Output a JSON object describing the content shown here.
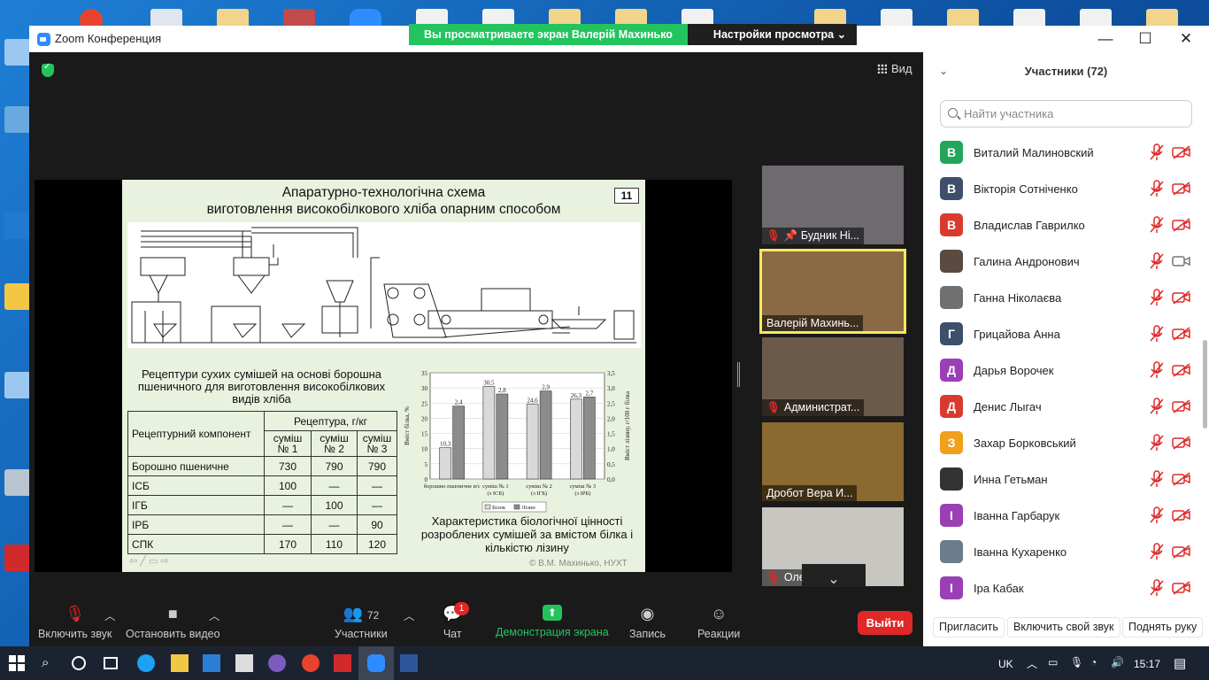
{
  "window": {
    "title": "Zoom Конференция"
  },
  "share_bar": {
    "viewing": "Вы просматриваете экран Валерій Махинько",
    "settings": "Настройки просмотра"
  },
  "view_button": "Вид",
  "slide": {
    "number": "11",
    "title_line1": "Апаратурно-технологічна схема",
    "title_line2": "виготовлення високобілкового хліба опарним способом",
    "table_caption": "Рецептури сухих сумішей на основі борошна пшеничного для виготовлення високобілкових видів хліба",
    "table": {
      "header_component": "Рецептурний компонент",
      "header_recipe": "Рецептура, г/кг",
      "cols": [
        "суміш № 1",
        "суміш № 2",
        "суміш № 3"
      ],
      "rows": [
        {
          "name": "Борошно пшеничне",
          "values": [
            "730",
            "790",
            "790"
          ]
        },
        {
          "name": "ІСБ",
          "values": [
            "100",
            "—",
            "—"
          ]
        },
        {
          "name": "ІГБ",
          "values": [
            "—",
            "100",
            "—"
          ]
        },
        {
          "name": "ІРБ",
          "values": [
            "—",
            "—",
            "90"
          ]
        },
        {
          "name": "СПК",
          "values": [
            "170",
            "110",
            "120"
          ]
        }
      ]
    },
    "chart_caption": "Характеристика біологічної цінності розроблених сумішей за вмістом білка і кількістю лізину",
    "copyright": "© В.М. Махинько, НУХТ"
  },
  "chart_data": {
    "type": "bar",
    "categories": [
      "борошно пшеничне в/с",
      "суміш № 1 (з ІСБ)",
      "суміш № 2 (з ІГБ)",
      "суміш № 3 (з ІРБ)"
    ],
    "series": [
      {
        "name": "Білок",
        "values": [
          10.3,
          30.5,
          24.6,
          26.3
        ],
        "color": "#d9d9d9"
      },
      {
        "name": "Лізин",
        "values": [
          2.4,
          2.8,
          2.9,
          2.7
        ],
        "color": "#8c8c8c"
      }
    ],
    "ylabel": "Вміст білка, %",
    "y2label": "Вміст лізину, г/100 г білка",
    "ylim": [
      0,
      35
    ],
    "y2lim": [
      0,
      3.5
    ],
    "yticks": [
      "0",
      "5",
      "10",
      "15",
      "20",
      "25",
      "30",
      "35"
    ],
    "y2ticks": [
      "0,0",
      "0,5",
      "1,0",
      "1,5",
      "2,0",
      "2,5",
      "3,0",
      "3,5"
    ],
    "data_labels": [
      [
        "10,3",
        "2,4"
      ],
      [
        "30,5",
        "2,8"
      ],
      [
        "24,6",
        "2,9"
      ],
      [
        "26,3",
        "2,7"
      ]
    ],
    "legend": "bottom"
  },
  "thumbnails": [
    {
      "name": "Будник Ні...",
      "muted": true,
      "bg": "#6e6a70"
    },
    {
      "name": "Валерій Махинь...",
      "muted": false,
      "bg": "#8a6a44"
    },
    {
      "name": "Администрат...",
      "muted": true,
      "bg": "#6b5a4a"
    },
    {
      "name": "Дробот Вера И...",
      "muted": false,
      "bg": "#8a6a30"
    },
    {
      "name": "Олена Кохан",
      "muted": true,
      "bg": "#c8c6c0"
    }
  ],
  "toolbar": {
    "audio": "Включить звук",
    "video": "Остановить видео",
    "participants": "Участники",
    "participants_count": "72",
    "chat": "Чат",
    "chat_badge": "1",
    "share": "Демонстрация экрана",
    "record": "Запись",
    "reactions": "Реакции",
    "leave": "Выйти"
  },
  "panel": {
    "title": "Участники (72)",
    "search_placeholder": "Найти участника",
    "participants": [
      {
        "initial": "В",
        "name": "Виталий Малиновский",
        "color": "#23a55a",
        "cam": "off"
      },
      {
        "initial": "В",
        "name": "Вікторія Сотніченко",
        "color": "#3d4f6b",
        "cam": "off"
      },
      {
        "initial": "В",
        "name": "Владислав Гаврилко",
        "color": "#d83b2d",
        "cam": "off"
      },
      {
        "initial": "",
        "name": "Галина Андронович",
        "color": "#5a4a40",
        "cam": "on"
      },
      {
        "initial": "",
        "name": "Ганна Ніколаєва",
        "color": "#707070",
        "cam": "off"
      },
      {
        "initial": "Г",
        "name": "Грицайова Анна",
        "color": "#3d4f6b",
        "cam": "off"
      },
      {
        "initial": "Д",
        "name": "Дарья Ворочек",
        "color": "#9b3fb5",
        "cam": "off"
      },
      {
        "initial": "Д",
        "name": "Денис Лыгач",
        "color": "#d83b2d",
        "cam": "off"
      },
      {
        "initial": "З",
        "name": "Захар Борковський",
        "color": "#f0a01c",
        "cam": "off"
      },
      {
        "initial": "",
        "name": "Инна Гетьман",
        "color": "#333333",
        "cam": "off"
      },
      {
        "initial": "І",
        "name": "Іванна Гарбарук",
        "color": "#9b3fb5",
        "cam": "off"
      },
      {
        "initial": "",
        "name": "Іванна Кухаренко",
        "color": "#6b7c8c",
        "cam": "off"
      },
      {
        "initial": "І",
        "name": "Іра Кабак",
        "color": "#9b3fb5",
        "cam": "off"
      }
    ],
    "invite": "Пригласить",
    "unmute_me": "Включить свой звук",
    "raise_hand": "Поднять руку"
  },
  "taskbar": {
    "lang": "UK",
    "time": "15:17"
  }
}
